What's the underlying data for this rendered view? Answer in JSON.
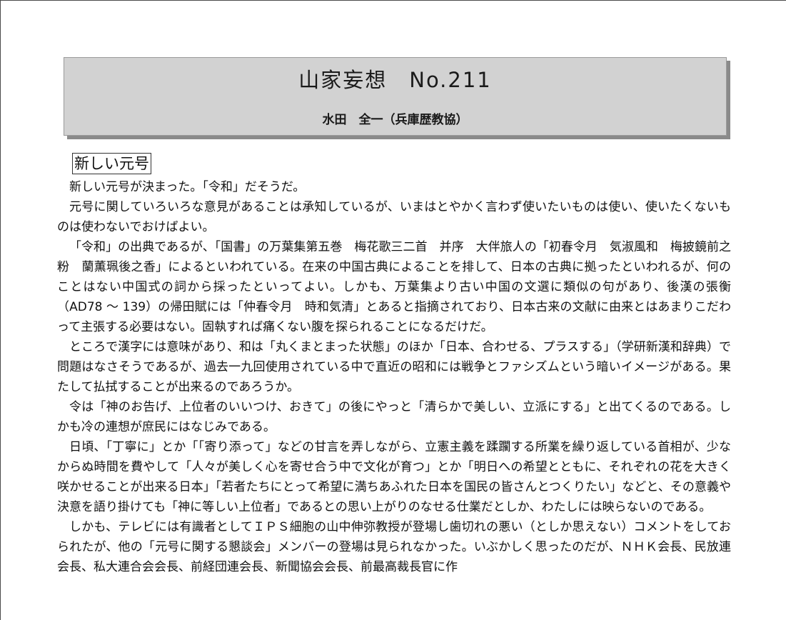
{
  "header": {
    "title": "山家妄想　No.211",
    "author": "水田　全一（兵庫歴教協）"
  },
  "article": {
    "heading": "新しい元号",
    "paragraphs": [
      "新しい元号が決まった。「令和」だそうだ。",
      "元号に関していろいろな意見があることは承知しているが、いまはとやかく言わず使いたいものは使い、使いたくないものは使わないでおけばよい。",
      "「令和」の出典であるが、「国書」の万葉集第五巻　梅花歌三二首　并序　大伴旅人の「初春令月　気淑風和　梅披鏡前之粉　蘭薫珮後之香」によるといわれている。在来の中国古典によることを排して、日本の古典に拠ったといわれるが、何のことはない中国式の詞から採ったといってよい。しかも、万葉集より古い中国の文選に類似の句があり、後漢の張衡（AD78 ～ 139）の帰田賦には「仲春令月　時和気清」とあると指摘されており、日本古来の文献に由来とはあまりこだわって主張する必要はない。固執すれば痛くない腹を探られることになるだけだ。",
      "ところで漢字には意味があり、和は「丸くまとまった状態」のほか「日本、合わせる、プラスする」（学研新漢和辞典）で問題はなさそうであるが、過去一九回使用されている中で直近の昭和には戦争とファシズムという暗いイメージがある。果たして払拭することが出来るのであろうか。",
      "令は「神のお告げ、上位者のいいつけ、おきて」の後にやっと「清らかで美しい、立派にする」と出てくるのである。しかも冷の連想が庶民にはなじみである。",
      "日頃、「丁寧に」とか「「寄り添って」などの甘言を弄しながら、立憲主義を蹂躙する所業を繰り返している首相が、少なからぬ時間を費やして「人々が美しく心を寄せ合う中で文化が育つ」とか「明日への希望とともに、それぞれの花を大きく咲かせることが出来る日本」「若者たちにとって希望に満ちあふれた日本を国民の皆さんとつくりたい」などと、その意義や決意を語り掛けても「神に等しい上位者」であるとの思い上がりのなせる仕業だとしか、わたしには映らないのである。",
      "しかも、テレビには有識者としてＩＰＳ細胞の山中伸弥教授が登場し歯切れの悪い（としか思えない）コメントをしておられたが、他の「元号に関する懇談会」メンバーの登場は見られなかった。いぶかしく思ったのだが、ＮＨＫ会長、民放連会長、私大連合会会長、前経団連会長、新聞協会会長、前最高裁長官に作"
    ]
  }
}
